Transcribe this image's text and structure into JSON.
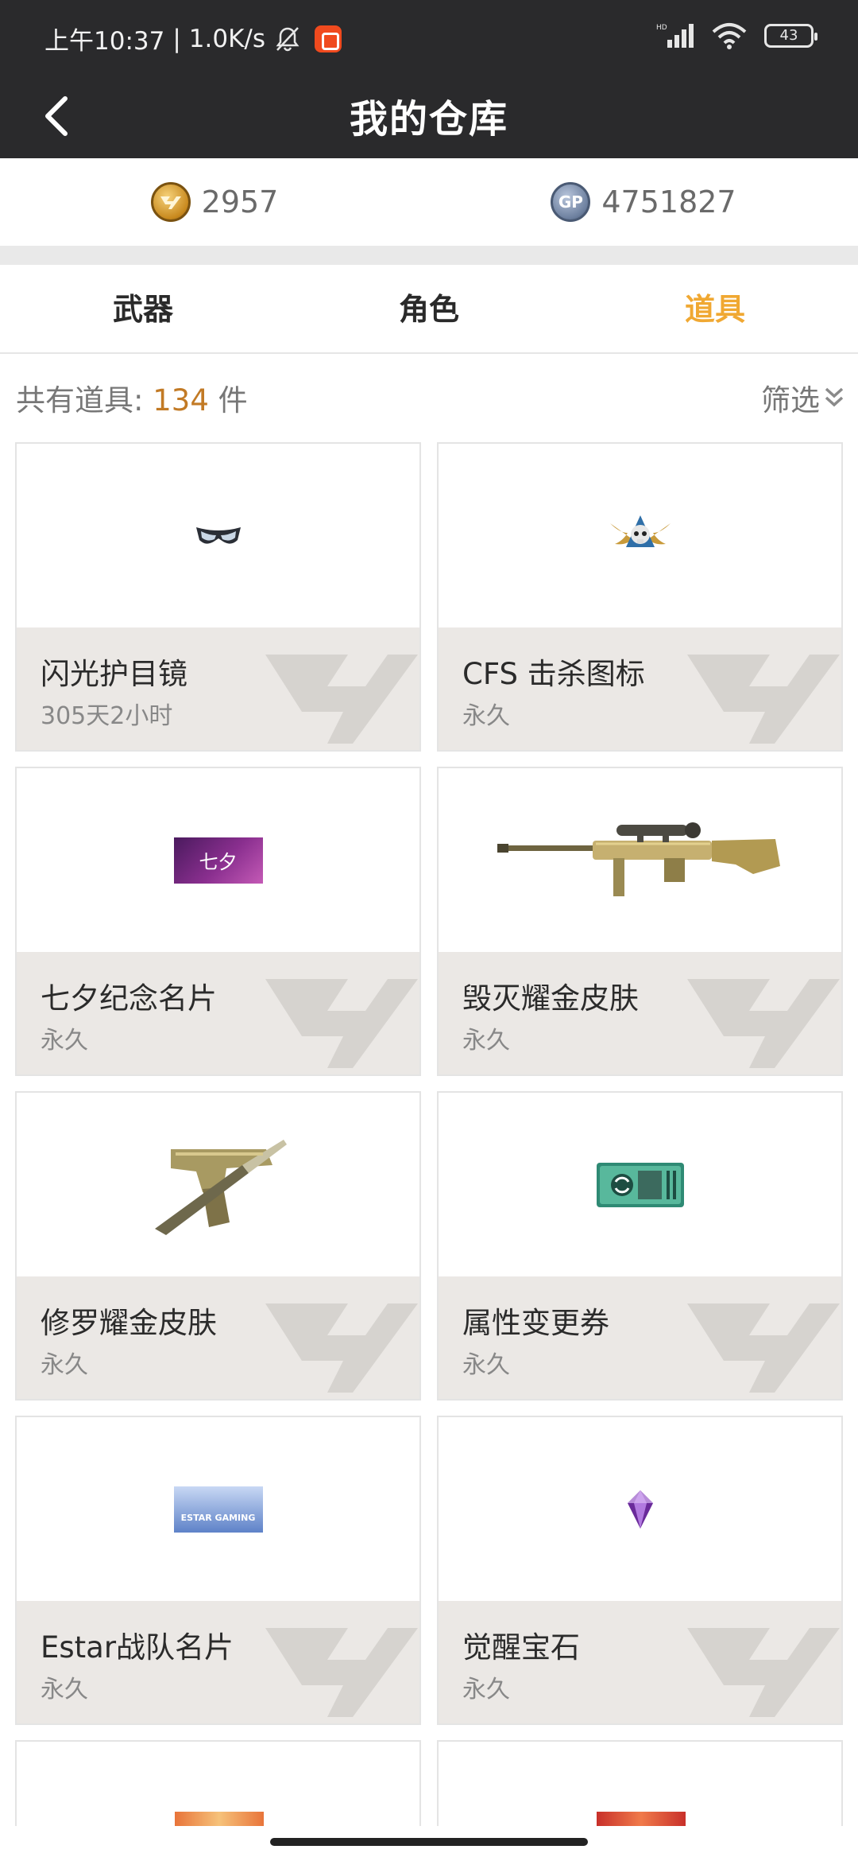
{
  "status": {
    "time": "上午10:37",
    "speed": "1.0K/s",
    "battery": "43"
  },
  "header": {
    "title": "我的仓库"
  },
  "currency": {
    "cf_amount": "2957",
    "gp_label": "GP",
    "gp_amount": "4751827"
  },
  "tabs": [
    {
      "label": "武器"
    },
    {
      "label": "角色"
    },
    {
      "label": "道具"
    }
  ],
  "active_tab": 2,
  "summary": {
    "prefix": "共有道具:",
    "count": "134",
    "suffix": "件",
    "filter_label": "筛选"
  },
  "items": [
    {
      "name": "闪光护目镜",
      "duration": "305天2小时",
      "icon": "goggles-icon"
    },
    {
      "name": "CFS 击杀图标",
      "duration": "永久",
      "icon": "skull-emblem-icon"
    },
    {
      "name": "七夕纪念名片",
      "duration": "永久",
      "icon": "qixi-card-icon",
      "image_text": "七夕"
    },
    {
      "name": "毁灭耀金皮肤",
      "duration": "永久",
      "icon": "golden-sniper-rifle-icon"
    },
    {
      "name": "修罗耀金皮肤",
      "duration": "永久",
      "icon": "golden-pistol-knife-icon"
    },
    {
      "name": "属性变更券",
      "duration": "永久",
      "icon": "attribute-ticket-icon"
    },
    {
      "name": "Estar战队名片",
      "duration": "永久",
      "icon": "estar-card-icon",
      "image_text": "ESTAR GAMING"
    },
    {
      "name": "觉醒宝石",
      "duration": "永久",
      "icon": "awaken-gem-icon"
    }
  ],
  "colors": {
    "header_bg": "#2a2a2c",
    "accent": "#f0a832",
    "count": "#c27a25",
    "card_info_bg": "#ebe8e5"
  }
}
